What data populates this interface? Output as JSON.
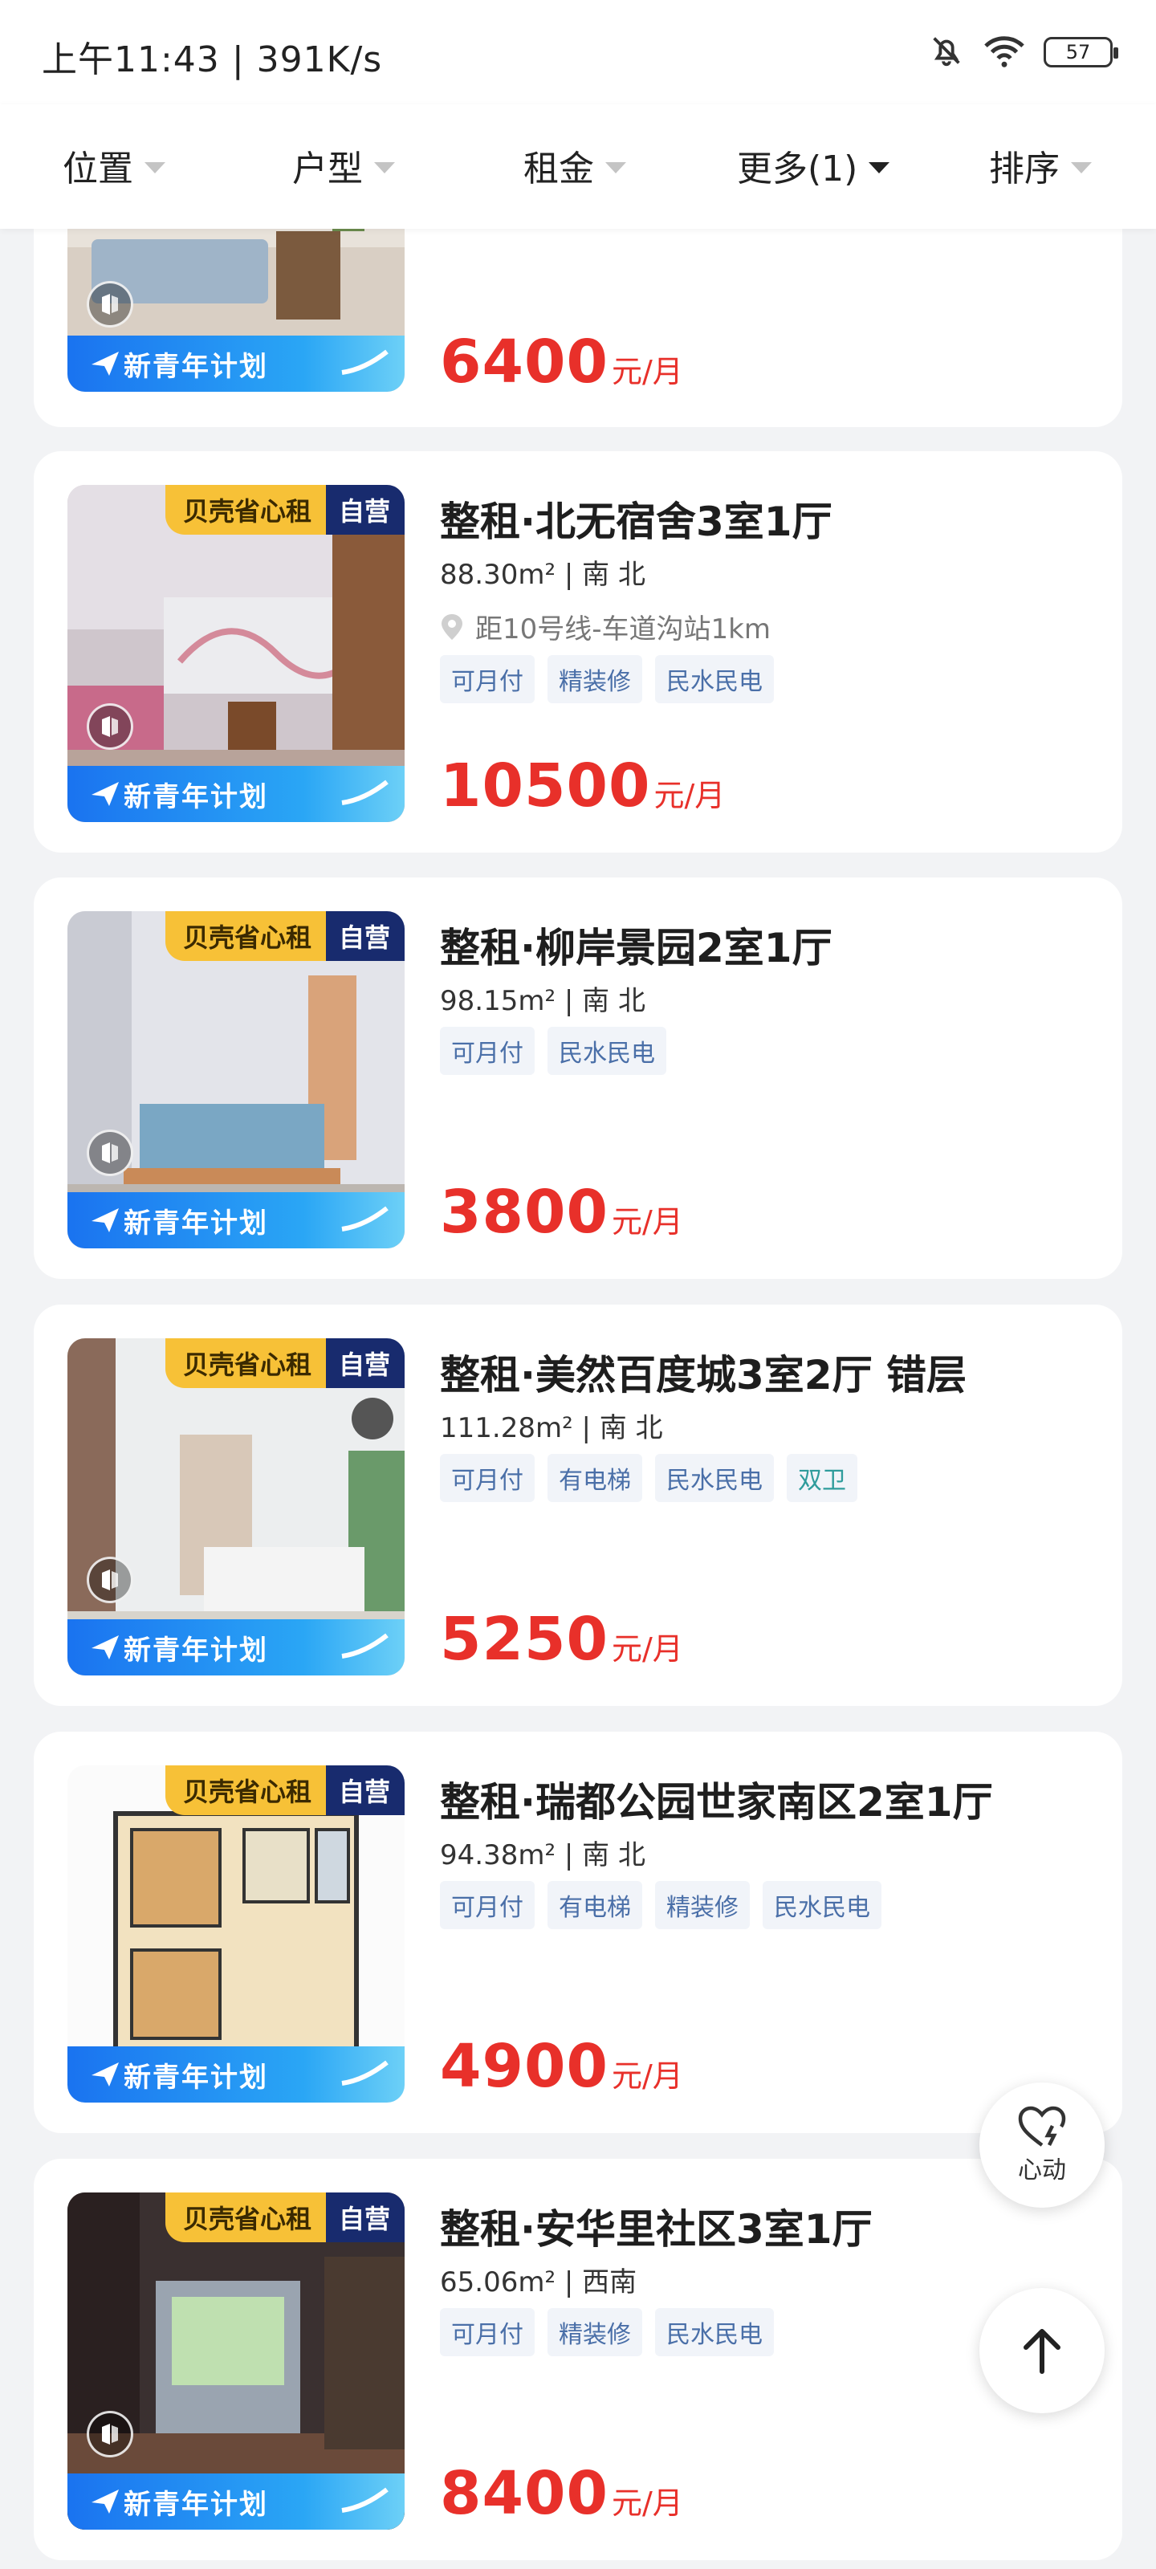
{
  "status": {
    "time": "上午11:43",
    "speed": "391K/s",
    "battery": "57"
  },
  "filters": [
    {
      "label": "位置"
    },
    {
      "label": "户型"
    },
    {
      "label": "租金"
    },
    {
      "label": "更多(1)"
    },
    {
      "label": "排序"
    }
  ],
  "badges": {
    "ke": "贝壳省心租",
    "self": "自营",
    "plan": "新青年计划"
  },
  "price_unit": "元/月",
  "listings": [
    {
      "title": "",
      "meta": "",
      "tags": [],
      "price": "6400"
    },
    {
      "title": "整租·北无宿舍3室1厅",
      "meta": "88.30m² | 南 北",
      "location": "距10号线-车道沟站1km",
      "tags": [
        "可月付",
        "精装修",
        "民水民电"
      ],
      "price": "10500"
    },
    {
      "title": "整租·柳岸景园2室1厅",
      "meta": "98.15m² | 南 北",
      "tags": [
        "可月付",
        "民水民电"
      ],
      "price": "3800"
    },
    {
      "title": "整租·美然百度城3室2厅 错层",
      "meta": "111.28m² | 南 北",
      "tags": [
        "可月付",
        "有电梯",
        "民水民电",
        "双卫"
      ],
      "price": "5250"
    },
    {
      "title": "整租·瑞都公园世家南区2室1厅",
      "meta": "94.38m² | 南 北",
      "tags": [
        "可月付",
        "有电梯",
        "精装修",
        "民水民电"
      ],
      "price": "4900"
    },
    {
      "title": "整租·安华里社区3室1厅",
      "meta": "65.06m² | 西南",
      "tags": [
        "可月付",
        "精装修",
        "民水民电"
      ],
      "price": "8400"
    }
  ],
  "fab": {
    "favorite_label": "心动"
  }
}
